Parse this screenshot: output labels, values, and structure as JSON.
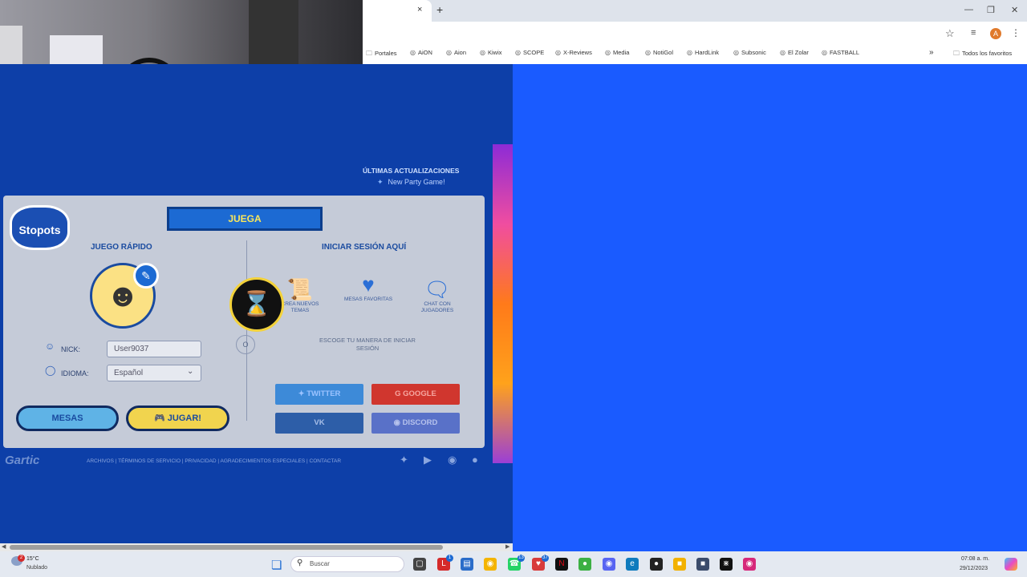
{
  "browser": {
    "bookmarks": [
      "Portales",
      "AiON",
      "Aion",
      "Kiwix",
      "SCOPE",
      "X-Reviews",
      "Media",
      "NotiGol",
      "HardLink",
      "Subsonic",
      "El Zolar",
      "FASTBALL"
    ],
    "more": "»",
    "all_favorites": "Todos los favoritos",
    "profile_initial": "A",
    "new_tab": "+",
    "close_tab": "×"
  },
  "site": {
    "updates_title": "ÚLTIMAS ACTUALIZACIONES",
    "updates_item": "New Party Game!",
    "logo": "Stopots",
    "ribbon": "JUEGA",
    "quick_game_title": "JUEGO RÁPIDO",
    "login_title": "INICIAR SESIÓN AQUÍ",
    "nick_label": "NICK:",
    "nick_value": "User9037",
    "language_label": "IDIOMA:",
    "language_value": "Español",
    "mesas_button": "MESAS",
    "jugar_button": "JUGAR!",
    "features": [
      {
        "label": "CREA NUEVOS TEMAS",
        "icon": "scroll-icon"
      },
      {
        "label": "MESAS FAVORITAS",
        "icon": "heart-icon"
      },
      {
        "label": "CHAT CON JUGADORES",
        "icon": "chat-icon"
      }
    ],
    "or": "O",
    "choose_login": "ESCOGE TU MANERA DE INICIAR SESIÓN",
    "twitter": "TWITTER",
    "google": "GOOGLE",
    "vk": "VK",
    "discord": "DISCORD",
    "brand": "Gartic",
    "footer_links": "ARCHIVOS | TÉRMINOS DE SERVICIO | PRIVACIDAD | AGRADECIMIENTOS ESPECIALES | CONTACTAR"
  },
  "taskbar": {
    "weather_temp": "15°C",
    "weather_condition": "Nublado",
    "weather_badge": "2",
    "search_placeholder": "Buscar",
    "clock_time": "07:08 a. m.",
    "clock_date": "29/12/2023",
    "badge_1": "1",
    "badge_2": "13",
    "badge_3": "37"
  }
}
